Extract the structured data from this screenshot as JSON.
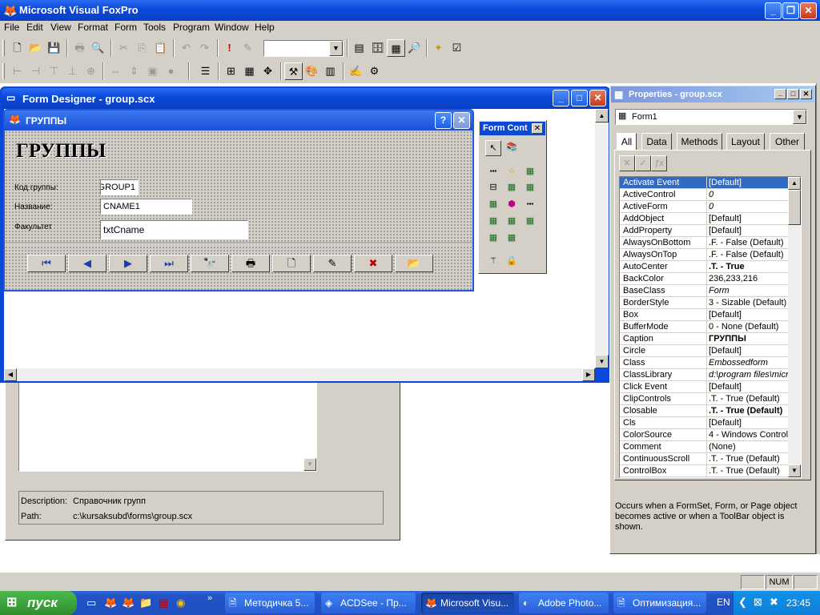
{
  "app": {
    "title": "Microsoft Visual FoxPro"
  },
  "menu": [
    "File",
    "Edit",
    "View",
    "Format",
    "Form",
    "Tools",
    "Program",
    "Window",
    "Help"
  ],
  "toolbar": {
    "combo_value": ""
  },
  "form_designer": {
    "title": "Form Designer - group.scx"
  },
  "form": {
    "title": "ГРУППЫ",
    "heading": "ГРУППЫ",
    "fields": [
      {
        "label": "Код группы:",
        "value": "GROUP1"
      },
      {
        "label": "Название:",
        "value": "CNAME1"
      },
      {
        "label": "Факультет",
        "value": "txtCname"
      }
    ]
  },
  "form_controls": {
    "title": "Form Cont"
  },
  "project_info": {
    "description_label": "Description:",
    "description": "Справочник групп",
    "path_label": "Path:",
    "path": "c:\\kursaksubd\\forms\\group.scx"
  },
  "properties": {
    "title": "Properties - group.scx",
    "object": "Form1",
    "tabs": [
      "All",
      "Data",
      "Methods",
      "Layout",
      "Other"
    ],
    "active_tab": "All",
    "rows": [
      {
        "name": "Activate Event",
        "value": "[Default]"
      },
      {
        "name": "ActiveControl",
        "value": "0"
      },
      {
        "name": "ActiveForm",
        "value": "0"
      },
      {
        "name": "AddObject",
        "value": "[Default]"
      },
      {
        "name": "AddProperty",
        "value": "[Default]"
      },
      {
        "name": "AlwaysOnBottom",
        "value": ".F. - False (Default)"
      },
      {
        "name": "AlwaysOnTop",
        "value": ".F. - False (Default)"
      },
      {
        "name": "AutoCenter",
        "value": ".T. - True"
      },
      {
        "name": "BackColor",
        "value": "236,233,216"
      },
      {
        "name": "BaseClass",
        "value": "Form"
      },
      {
        "name": "BorderStyle",
        "value": "3 - Sizable (Default)"
      },
      {
        "name": "Box",
        "value": "[Default]"
      },
      {
        "name": "BufferMode",
        "value": "0 - None (Default)"
      },
      {
        "name": "Caption",
        "value": "ГРУППЫ"
      },
      {
        "name": "Circle",
        "value": "[Default]"
      },
      {
        "name": "Class",
        "value": "Embossedform"
      },
      {
        "name": "ClassLibrary",
        "value": "d:\\program files\\micr"
      },
      {
        "name": "Click Event",
        "value": "[Default]"
      },
      {
        "name": "ClipControls",
        "value": ".T. - True (Default)"
      },
      {
        "name": "Closable",
        "value": ".T. - True (Default)"
      },
      {
        "name": "Cls",
        "value": "[Default]"
      },
      {
        "name": "ColorSource",
        "value": "4 - Windows Control P"
      },
      {
        "name": "Comment",
        "value": "(None)"
      },
      {
        "name": "ContinuousScroll",
        "value": ".T. - True (Default)"
      },
      {
        "name": "ControlBox",
        "value": ".T. - True (Default)"
      }
    ],
    "description": "Occurs when a FormSet, Form, or Page object becomes active or when a ToolBar object is shown."
  },
  "status": {
    "num": "NUM"
  },
  "taskbar": {
    "start": "пуск",
    "buttons": [
      "Методичка 5...",
      "ACDSee - Пр...",
      "Microsoft Visu...",
      "Adobe Photo...",
      "Оптимизация..."
    ],
    "lang": "EN",
    "clock": "23:45"
  },
  "colors": {
    "xp_blue": "#0a48d8",
    "selection": "#316ac5",
    "face": "#d4d0c8"
  }
}
